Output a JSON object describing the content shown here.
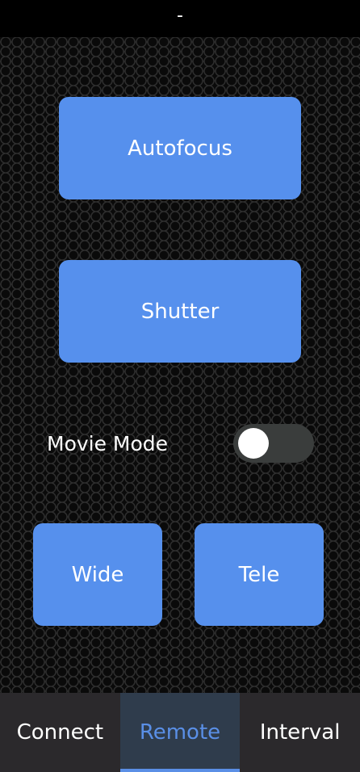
{
  "app": {
    "title": "-"
  },
  "remote": {
    "autofocus_label": "Autofocus",
    "shutter_label": "Shutter",
    "movie_mode_label": "Movie Mode",
    "movie_mode_on": false,
    "wide_label": "Wide",
    "tele_label": "Tele"
  },
  "tabs": [
    {
      "label": "Connect",
      "active": false
    },
    {
      "label": "Remote",
      "active": true
    },
    {
      "label": "Interval",
      "active": false
    }
  ],
  "colors": {
    "button": "#5690ed",
    "active_tab_text": "#5a8fe6",
    "tab_bar": "#2b292c",
    "active_tab_bg": "#2f3c4c",
    "toggle_track_off": "#3a3d3c"
  }
}
